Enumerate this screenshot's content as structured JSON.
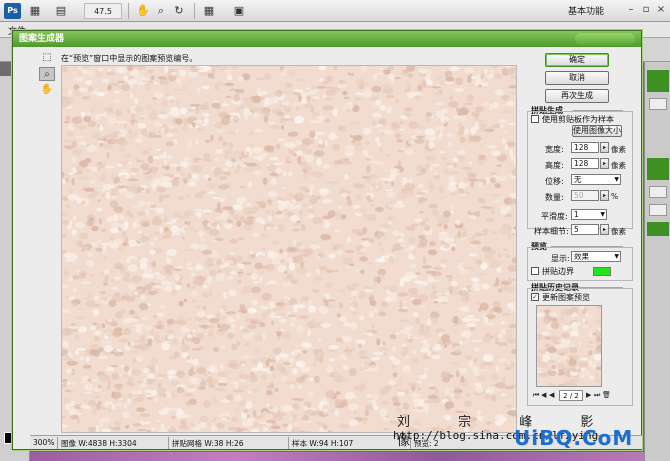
{
  "app": {
    "zoom": "47.5",
    "workspace": "基本功能",
    "menu_first": "文件"
  },
  "dialog": {
    "title": "图案生成器",
    "hint": "在“预览”窗口中显示的图案预览编号。",
    "buttons": {
      "ok": "确定",
      "cancel": "取消",
      "regenerate": "再次生成"
    },
    "tile_generation": {
      "label": "拼贴生成",
      "use_clipboard": {
        "label": "使用剪贴板作为样本",
        "checked": false
      },
      "use_image_size": "使用图像大小",
      "width": {
        "label": "宽度:",
        "value": "128",
        "unit": "像素"
      },
      "height": {
        "label": "高度:",
        "value": "128",
        "unit": "像素"
      },
      "offset": {
        "label": "位移:",
        "value": "无"
      },
      "amount": {
        "label": "数量:",
        "value": "50",
        "unit": "%"
      },
      "smoothness": {
        "label": "平滑度:",
        "value": "1"
      },
      "sample_detail": {
        "label": "样本细节:",
        "value": "5",
        "unit": "像素"
      }
    },
    "preview_group": {
      "label": "预览",
      "show": {
        "label": "显示:",
        "value": "效果"
      },
      "tile_boundaries": {
        "label": "拼贴边界",
        "checked": false,
        "color": "#22e31c"
      }
    },
    "tile_history": {
      "label": "拼贴历史记录",
      "update_preview": {
        "label": "更新图案预览",
        "checked": true
      },
      "page": "2 / 2"
    },
    "status": {
      "zoom": "300%",
      "image": "图像 W:4838 H:3304",
      "grid": "拼贴网格 W:38 H:26",
      "sample": "样本 W:94 H:107",
      "preview": "预览: 2"
    }
  },
  "watermark": {
    "name": "刘 宗 峰 影 像",
    "url": "http://blog.sina.com.cn/lfzying",
    "site": "UiBQ.CoM"
  },
  "colors": {
    "accent": "#4e9a2a",
    "texture": "#f1dccf"
  }
}
